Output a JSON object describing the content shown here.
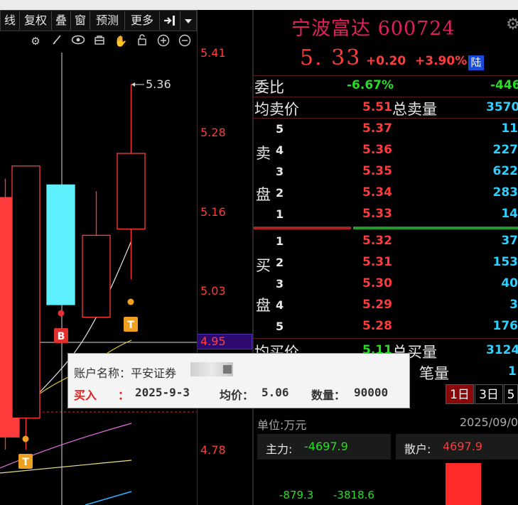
{
  "toolbar": {
    "buttons": [
      "画线",
      "复权",
      "叠",
      "窗",
      "预测",
      "更多"
    ],
    "button_visible": [
      "线",
      "复权",
      "叠",
      "窗",
      "预测",
      "更多"
    ]
  },
  "chart": {
    "price_ticks": [
      "5.41",
      "5.28",
      "5.16",
      "5.03",
      "4.78"
    ],
    "current_price_tag": "4.95",
    "high_annotation": "5.36",
    "buy_marker": "B",
    "t_marker_1": "T",
    "t_marker_2": "T"
  },
  "chart_data": {
    "type": "candlestick",
    "candles": [
      {
        "open": 5.18,
        "close": 4.8,
        "high": 5.21,
        "low": 4.78,
        "color": "#ff3b3b"
      },
      {
        "open": 4.83,
        "close": 5.23,
        "high": 5.23,
        "low": 4.78,
        "color": "#ff3b3b"
      },
      {
        "open": 5.2,
        "close": 5.01,
        "high": 5.2,
        "low": 5.01,
        "color": "#5ef0ff"
      },
      {
        "open": 4.99,
        "close": 5.12,
        "high": 5.19,
        "low": 4.99,
        "color": "#ff3b3b"
      },
      {
        "open": 5.13,
        "close": 5.25,
        "high": 5.36,
        "low": 5.05,
        "color": "#ff3b3b"
      }
    ]
  },
  "quote": {
    "name": "宁波富达",
    "code": "600724",
    "price": "5. 33",
    "change": "+0.20",
    "change_pct": "+3.90%",
    "market": "陆"
  },
  "stats": {
    "weibi_label": "委比",
    "weibi_pct": "-6.67%",
    "weibi_diff": "-446",
    "avg_sell_label": "均卖价",
    "avg_sell": "5.51",
    "total_sell_label": "总卖量",
    "total_sell": "3570",
    "avg_buy_label": "均买价",
    "avg_buy": "5.11",
    "total_buy_label": "总买量",
    "total_buy": "3124",
    "per_trade_label": "笔量",
    "per_trade": "1"
  },
  "sell_side": {
    "label1": "卖",
    "label2": "盘",
    "levels": [
      {
        "level": "5",
        "price": "5.37",
        "vol": "11"
      },
      {
        "level": "4",
        "price": "5.36",
        "vol": "227"
      },
      {
        "level": "3",
        "price": "5.35",
        "vol": "622"
      },
      {
        "level": "2",
        "price": "5.34",
        "vol": "283"
      },
      {
        "level": "1",
        "price": "5.33",
        "vol": "14"
      }
    ]
  },
  "buy_side": {
    "label1": "买",
    "label2": "盘",
    "levels": [
      {
        "level": "1",
        "price": "5.32",
        "vol": "37"
      },
      {
        "level": "2",
        "price": "5.31",
        "vol": "153"
      },
      {
        "level": "3",
        "price": "5.30",
        "vol": "40"
      },
      {
        "level": "4",
        "price": "5.29",
        "vol": "3"
      },
      {
        "level": "5",
        "price": "5.28",
        "vol": "176"
      }
    ]
  },
  "flow": {
    "tabs": [
      "1日",
      "3日",
      "5"
    ],
    "unit_label": "单位:万元",
    "date": "2025/09/0",
    "main_label": "主力:",
    "main_value": "-4697.9",
    "retail_label": "散户:",
    "retail_value": "4697.9",
    "sub_values": [
      "-879.3",
      "-3818.6"
    ]
  },
  "tooltip": {
    "account_label": "账户名称：平安证券",
    "action": "买入",
    "colon": "：",
    "date": "2025-9-3",
    "avg_label": "均价：",
    "avg_value": "5.06",
    "qty_label": "数量：",
    "qty_value": "90000"
  },
  "colors": {
    "up": "#ff3b3b",
    "down_candle": "#5ef0ff",
    "green": "#22e022",
    "cyan_vol": "#2fd0ff",
    "title": "#e0205a"
  }
}
